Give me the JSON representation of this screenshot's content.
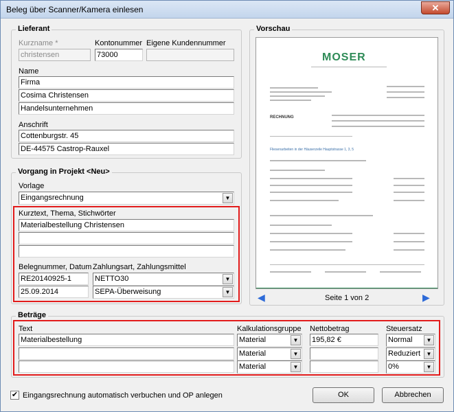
{
  "window": {
    "title": "Beleg über Scanner/Kamera einlesen",
    "close_symbol": "✕"
  },
  "lieferant": {
    "title": "Lieferant",
    "kurzname_label": "Kurzname *",
    "kurzname_value": "christensen",
    "kontonummer_label": "Kontonummer",
    "kontonummer_value": "73000",
    "eigene_kundennummer_label": "Eigene Kundennummer",
    "eigene_kundennummer_value": "",
    "name_label": "Name",
    "name_lines": [
      "Firma",
      "Cosima Christensen",
      "Handelsunternehmen"
    ],
    "anschrift_label": "Anschrift",
    "anschrift_lines": [
      "Cottenburgstr. 45",
      "DE-44575 Castrop-Rauxel"
    ]
  },
  "vorgang": {
    "title": "Vorgang in Projekt <Neu>",
    "vorlage_label": "Vorlage",
    "vorlage_value": "Eingangsrechnung",
    "kurztext_label": "Kurztext, Thema, Stichwörter",
    "kurztext_lines": [
      "Materialbestellung Christensen",
      "",
      ""
    ],
    "belegnummer_label": "Belegnummer, Datum",
    "belegnummer_value": "RE20140925-1",
    "datum_value": "25.09.2014",
    "zahlungsart_label": "Zahlungsart, Zahlungsmittel",
    "zahlungsart_value": "NETTO30",
    "zahlungsmittel_value": "SEPA-Überweisung"
  },
  "vorschau": {
    "title": "Vorschau",
    "page_label": "Seite 1 von 2",
    "doc_logo": "MOSER",
    "doc_heading": "RECHNUNG",
    "doc_subject": "Fliesenarbeiten in der Häuserzeile Hauptstrasse 1, 3, 5"
  },
  "betraege": {
    "title": "Beträge",
    "columns": {
      "text": "Text",
      "kalkulationsgruppe": "Kalkulationsgruppe",
      "nettobetrag": "Nettobetrag",
      "steuersatz": "Steuersatz"
    },
    "rows": [
      {
        "text": "Materialbestellung",
        "gruppe": "Material",
        "netto": "195,82 €",
        "steuer": "Normal"
      },
      {
        "text": "",
        "gruppe": "Material",
        "netto": "",
        "steuer": "Reduziert"
      },
      {
        "text": "",
        "gruppe": "Material",
        "netto": "",
        "steuer": "0%"
      }
    ]
  },
  "footer": {
    "checkbox_label": "Eingangsrechnung automatisch verbuchen und OP anlegen",
    "checkbox_checked": "✔",
    "ok_label": "OK",
    "cancel_label": "Abbrechen"
  },
  "icons": {
    "dropdown": "▼",
    "prev": "◀",
    "next": "▶"
  },
  "colors": {
    "highlight": "#e21b1b",
    "logo_green": "#2e8b57",
    "nav_arrow": "#2e6bd8"
  }
}
